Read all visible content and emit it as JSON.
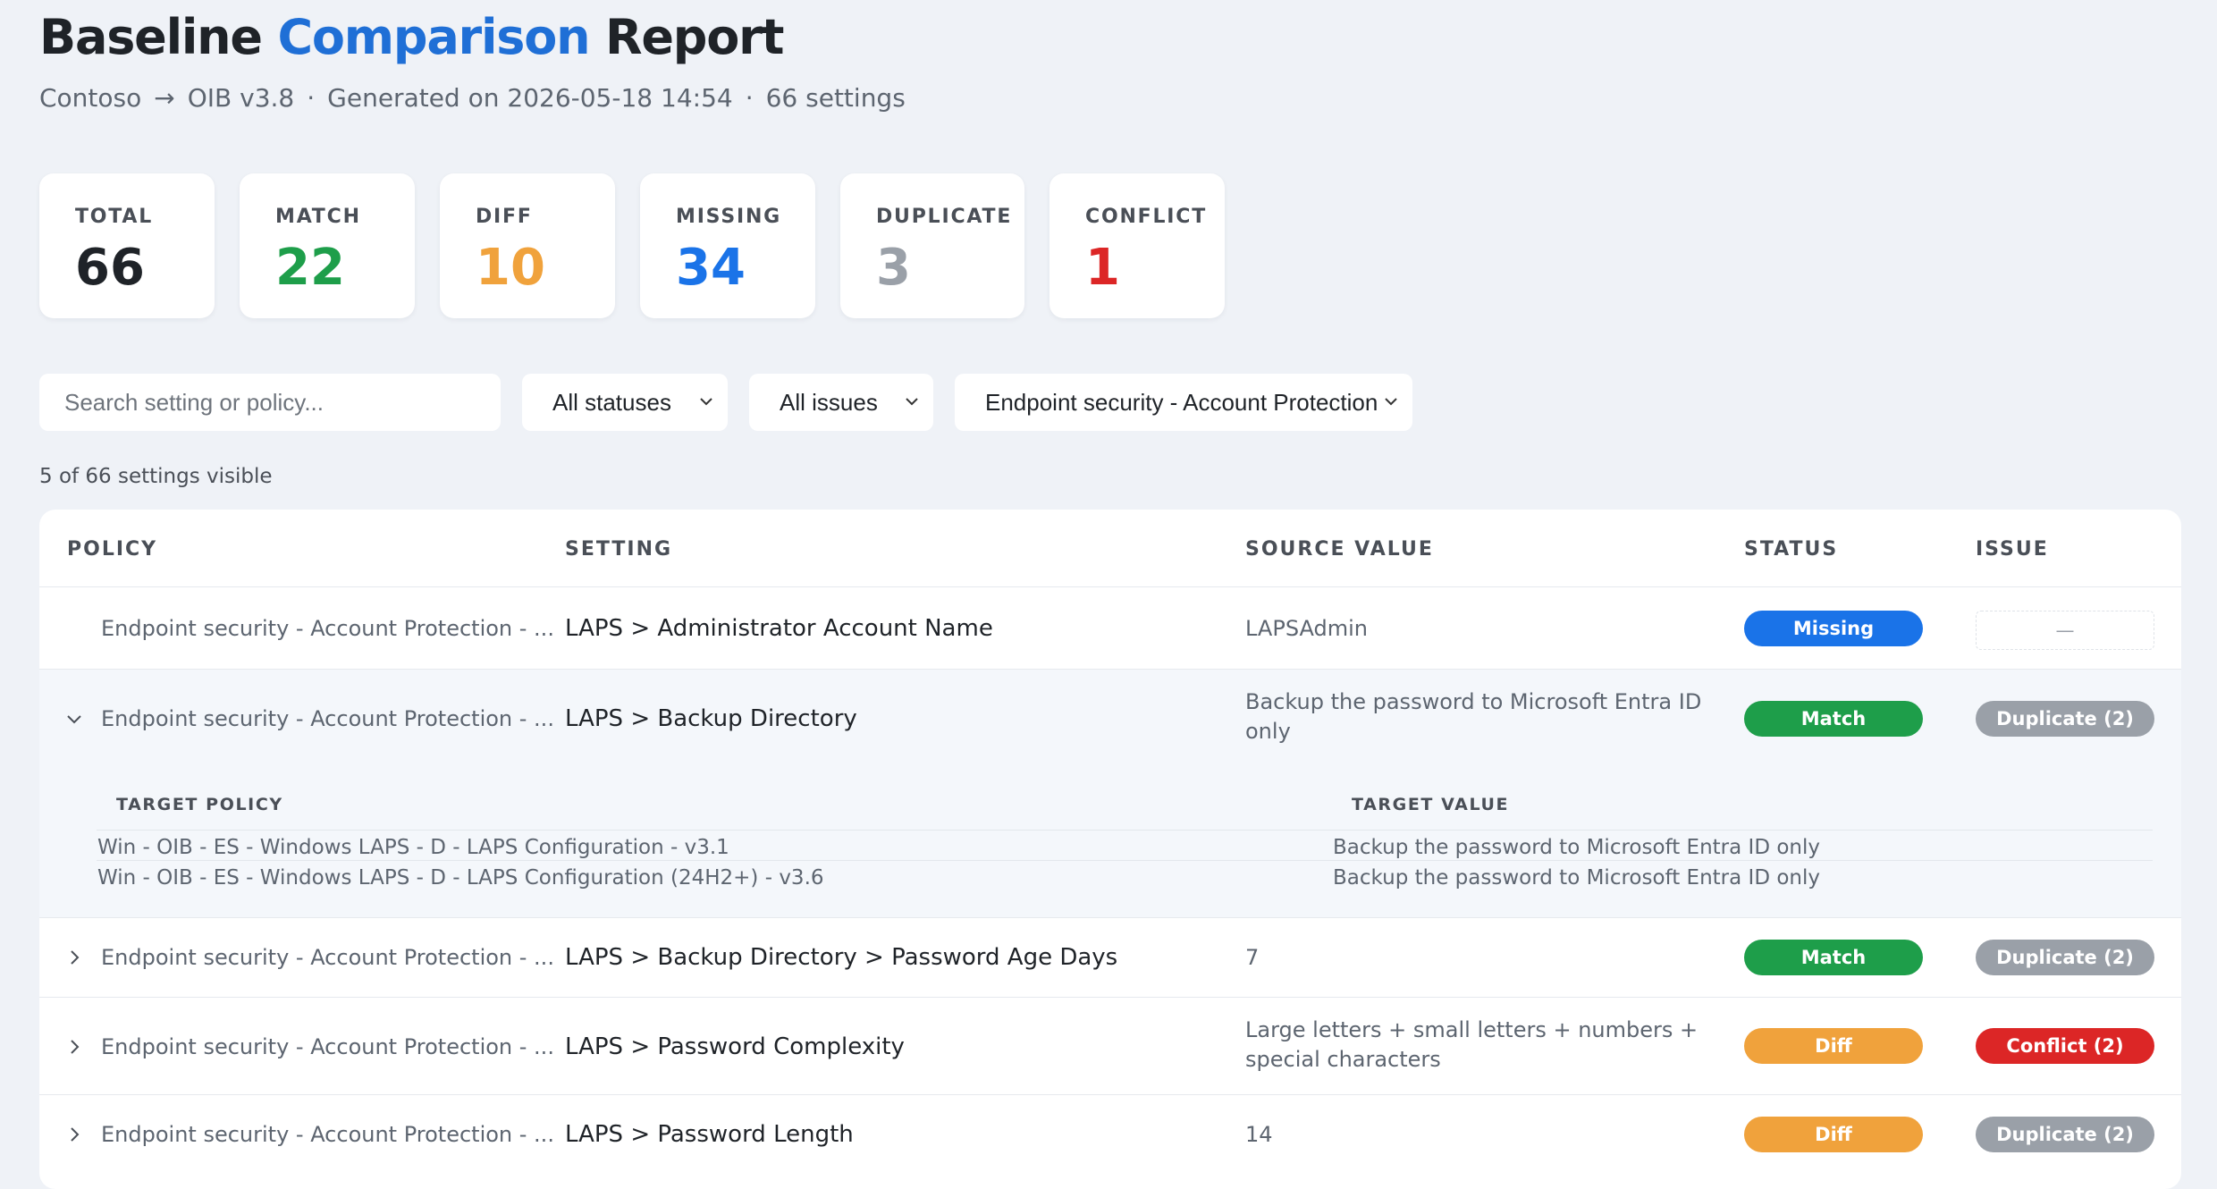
{
  "header": {
    "title_part1": "Baseline",
    "title_accent": "Comparison",
    "title_part2": "Report",
    "tenant": "Contoso",
    "arrow": "→",
    "baseline": "OIB v3.8",
    "dot": "·",
    "generated": "Generated on 2026-05-18 14:54",
    "settings_count": "66 settings"
  },
  "summary": {
    "cards": [
      {
        "label": "TOTAL",
        "value": "66",
        "color": "#1f2328"
      },
      {
        "label": "MATCH",
        "value": "22",
        "color": "#1e9e4a"
      },
      {
        "label": "DIFF",
        "value": "10",
        "color": "#f0a23c"
      },
      {
        "label": "MISSING",
        "value": "34",
        "color": "#1a73e8"
      },
      {
        "label": "DUPLICATE",
        "value": "3",
        "color": "#9aa0a8"
      },
      {
        "label": "CONFLICT",
        "value": "1",
        "color": "#dc2626"
      }
    ]
  },
  "filters": {
    "search_placeholder": "Search setting or policy...",
    "status": "All statuses",
    "issue": "All issues",
    "policy": "Endpoint security - Account Protection -"
  },
  "visible_text": "5 of 66 settings visible",
  "table": {
    "headers": {
      "policy": "POLICY",
      "setting": "SETTING",
      "source": "SOURCE VALUE",
      "status": "STATUS",
      "issue": "ISSUE"
    },
    "rows": [
      {
        "policy": "Endpoint security - Account Protection - ...",
        "setting": "LAPS > Administrator Account Name",
        "source": "LAPSAdmin",
        "status": "Missing",
        "issue": "—"
      },
      {
        "policy": "Endpoint security - Account Protection - ...",
        "setting": "LAPS > Backup Directory",
        "source": "Backup the password to Microsoft Entra ID only",
        "status": "Match",
        "issue": "Duplicate (2)"
      },
      {
        "policy": "Endpoint security - Account Protection - ...",
        "setting": "LAPS > Backup Directory > Password Age Days",
        "source": "7",
        "status": "Match",
        "issue": "Duplicate (2)"
      },
      {
        "policy": "Endpoint security - Account Protection - ...",
        "setting": "LAPS > Password Complexity",
        "source": "Large letters + small letters + numbers + special characters",
        "status": "Diff",
        "issue": "Conflict (2)"
      },
      {
        "policy": "Endpoint security - Account Protection - ...",
        "setting": "LAPS > Password Length",
        "source": "14",
        "status": "Diff",
        "issue": "Duplicate (2)"
      }
    ],
    "detail": {
      "headers": {
        "policy": "TARGET POLICY",
        "value": "TARGET VALUE"
      },
      "rows": [
        {
          "policy": "Win - OIB - ES - Windows LAPS - D - LAPS Configuration - v3.1",
          "value": "Backup the password to Microsoft Entra ID only"
        },
        {
          "policy": "Win - OIB - ES - Windows LAPS - D - LAPS Configuration (24H2+) - v3.6",
          "value": "Backup the password to Microsoft Entra ID only"
        }
      ]
    }
  }
}
